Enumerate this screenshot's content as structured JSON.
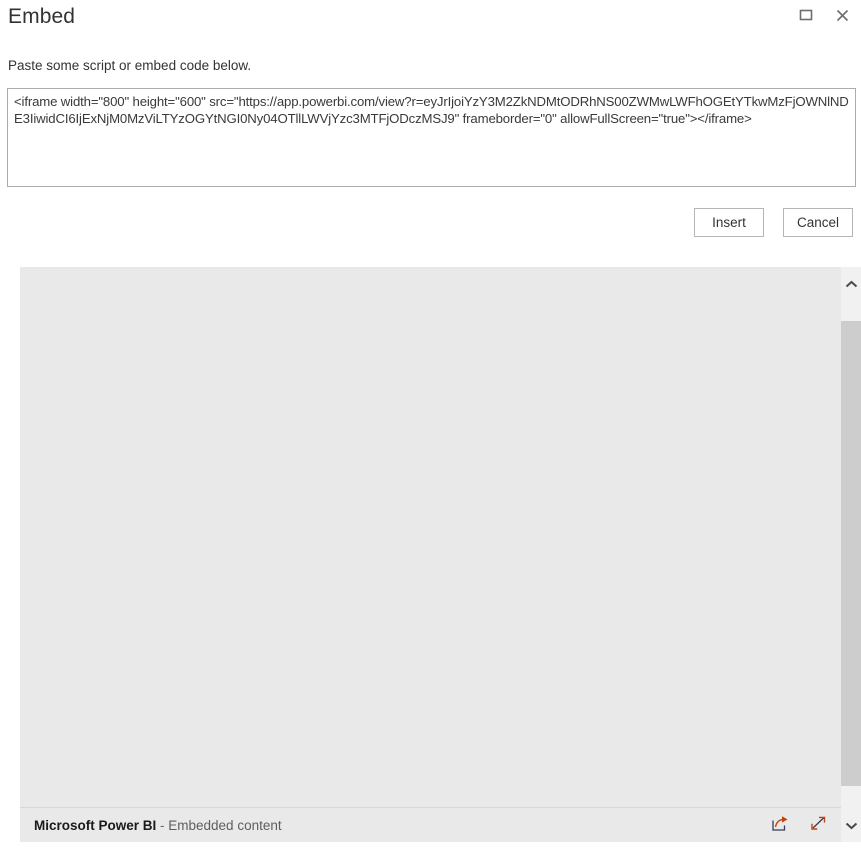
{
  "window": {
    "title": "Embed",
    "controls": [
      {
        "name": "restore-icon",
        "label": "Restore"
      },
      {
        "name": "close-icon",
        "label": "Close"
      }
    ]
  },
  "instruction": "Paste some script or embed code below.",
  "code_input": {
    "value": "<iframe width=\"800\" height=\"600\" src=\"https://app.powerbi.com/view?r=eyJrIjoiYzY3M2ZkNDMtODRhNS00ZWMwLWFhOGEtYTkwMzFjOWNlNDE3IiwidCI6IjExNjM0MzViLTYzOGYtNGI0Ny04OTllLWVjYzc3MTFjODczMSJ9\" frameborder=\"0\" allowFullScreen=\"true\"></iframe>",
    "placeholder": ""
  },
  "actions": {
    "insert_label": "Insert",
    "cancel_label": "Cancel"
  },
  "preview": {
    "footer": {
      "brand": "Microsoft Power BI",
      "separator": " - ",
      "subtitle": "Embedded content",
      "icons": [
        {
          "name": "share-icon",
          "label": "Share"
        },
        {
          "name": "fullscreen-icon",
          "label": "Enter full screen"
        }
      ]
    },
    "scrollbar": {
      "up_label": "Scroll up",
      "down_label": "Scroll down"
    }
  },
  "colors": {
    "panel_background": "#e9e9e9",
    "scrollbar_track": "#f1f1f1",
    "scrollbar_thumb": "#cdcdcd",
    "border": "#acacac"
  }
}
